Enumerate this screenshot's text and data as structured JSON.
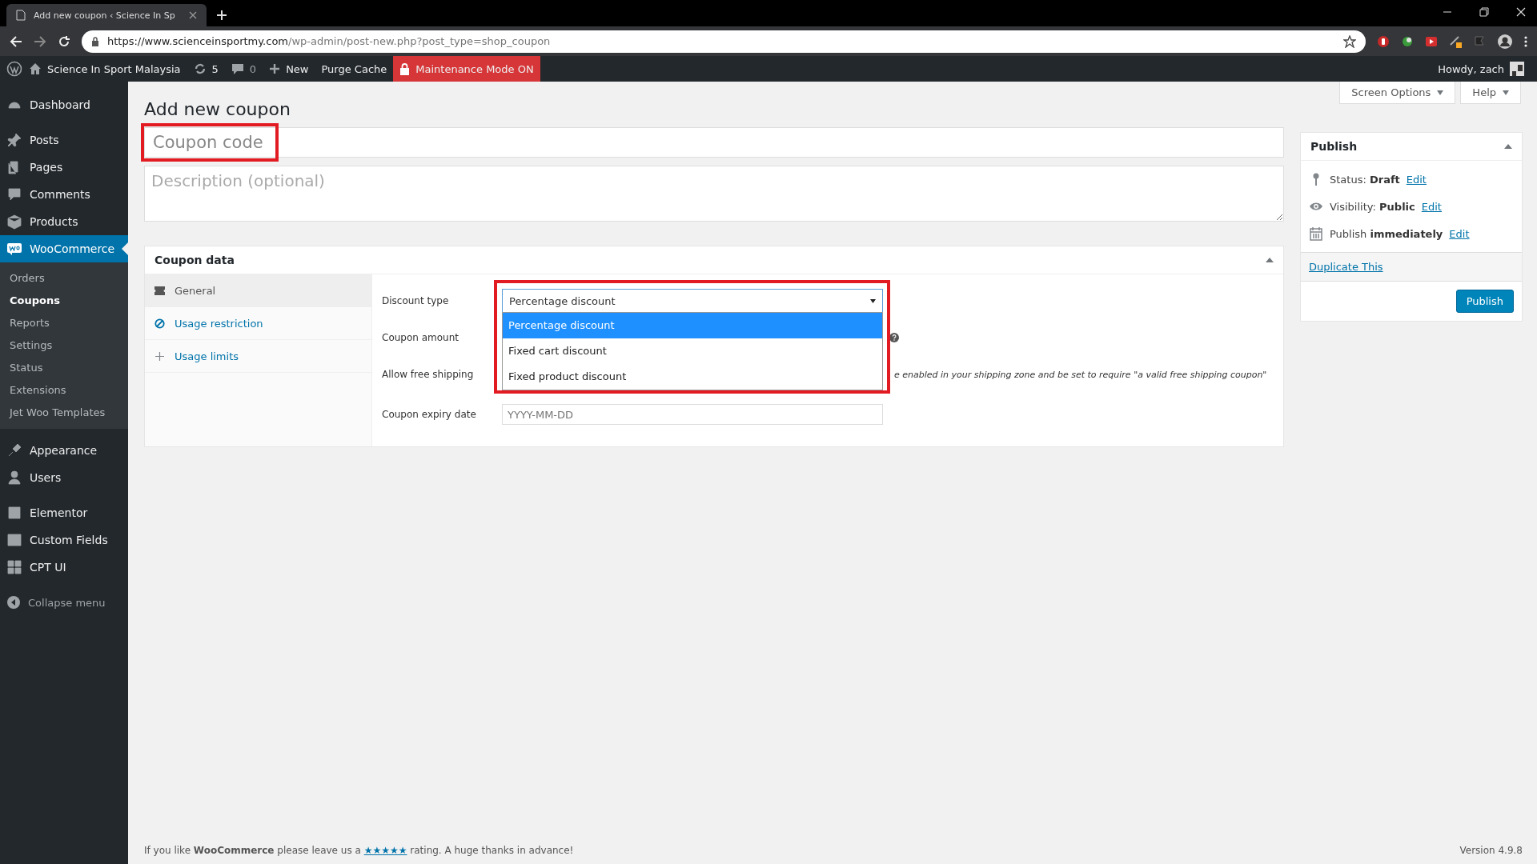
{
  "browser": {
    "tab_title": "Add new coupon ‹ Science In Sp",
    "url_host": "https://www.scienceinsportmy.com",
    "url_path": "/wp-admin/post-new.php?post_type=shop_coupon"
  },
  "admin_bar": {
    "site_name": "Science In Sport Malaysia",
    "updates": "5",
    "comments": "0",
    "new": "New",
    "purge": "Purge Cache",
    "maintenance": "Maintenance Mode ON",
    "howdy": "Howdy, zach"
  },
  "sidebar": {
    "groups": [
      [
        {
          "label": "Dashboard",
          "selected": false
        }
      ],
      [
        {
          "label": "Posts",
          "selected": false
        },
        {
          "label": "Pages",
          "selected": false
        },
        {
          "label": "Comments",
          "selected": false
        },
        {
          "label": "Products",
          "selected": false
        },
        {
          "label": "WooCommerce",
          "selected": true,
          "children": [
            {
              "label": "Orders",
              "selected": false
            },
            {
              "label": "Coupons",
              "selected": true
            },
            {
              "label": "Reports",
              "selected": false
            },
            {
              "label": "Settings",
              "selected": false
            },
            {
              "label": "Status",
              "selected": false
            },
            {
              "label": "Extensions",
              "selected": false
            },
            {
              "label": "Jet Woo Templates",
              "selected": false
            }
          ]
        }
      ],
      [
        {
          "label": "Appearance",
          "selected": false
        },
        {
          "label": "Users",
          "selected": false
        }
      ],
      [
        {
          "label": "Elementor",
          "selected": false
        },
        {
          "label": "Custom Fields",
          "selected": false
        },
        {
          "label": "CPT UI",
          "selected": false
        }
      ]
    ],
    "collapse": "Collapse menu"
  },
  "screen_meta": [
    "Screen Options",
    "Help"
  ],
  "page_title": "Add new coupon",
  "coupon_code": {
    "placeholder": "Coupon code"
  },
  "description": {
    "placeholder": "Description (optional)"
  },
  "coupon_data": {
    "title": "Coupon data",
    "tabs": [
      {
        "label": "General",
        "selected": true
      },
      {
        "label": "Usage restriction",
        "selected": false
      },
      {
        "label": "Usage limits",
        "selected": false
      }
    ],
    "discount_type": {
      "label": "Discount type",
      "value": "Percentage discount",
      "options": [
        {
          "label": "Percentage discount",
          "selected": true
        },
        {
          "label": "Fixed cart discount",
          "selected": false
        },
        {
          "label": "Fixed product discount",
          "selected": false
        }
      ]
    },
    "coupon_amount": {
      "label": "Coupon amount"
    },
    "free_shipping": {
      "label": "Allow free shipping",
      "note": "e enabled in your shipping zone and be set to require \"a valid free shipping coupon\""
    },
    "expiry": {
      "label": "Coupon expiry date",
      "placeholder": "YYYY-MM-DD"
    }
  },
  "publish": {
    "title": "Publish",
    "rows": [
      {
        "label": "Status:",
        "value": "Draft",
        "link": "Edit"
      },
      {
        "label": "Visibility:",
        "value": "Public",
        "link": "Edit"
      },
      {
        "label": "Publish",
        "value": "immediately",
        "link": "Edit"
      }
    ],
    "duplicate": "Duplicate This",
    "button": "Publish"
  },
  "footer": {
    "before": "If you like **WooCommerce** please leave us a",
    "stars": "★★★★★",
    "after": "rating. A huge thanks in advance!",
    "version": "Version 4.9.8"
  }
}
